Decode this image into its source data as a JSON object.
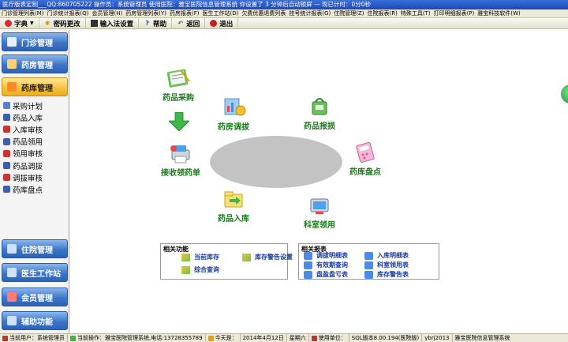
{
  "window": {
    "title": "医疗版表定制___QQ:860705222   操作员：系统管理员   使用医院：雅宝医院信息管理系统   你设置了 3 分钟后自动锁屏 — 现已计时：0分0秒"
  },
  "menu": [
    "门诊管理列表(M)",
    "门诊统计报表(Q)",
    "会员管理(H)",
    "药房管理列表(Y)",
    "药房报表(F)",
    "医生工作站(D)",
    "欠费优惠退费列表",
    "挂号统计报表(G)",
    "住院管理(Z)",
    "住院报表(R)",
    "特殊工具(T)",
    "打印明细报表(P)",
    "雅宝科技软件(W)"
  ],
  "toolbar": {
    "dictionary": "字典",
    "change_password": "密码更改",
    "input_method": "输入法设置",
    "help": "帮助",
    "back": "返回",
    "exit": "退出"
  },
  "sidebar": {
    "top_modules": [
      {
        "label": "门诊管理",
        "icon": "clinic-icon",
        "color": "#e8f0ff"
      },
      {
        "label": "药房管理",
        "icon": "pharmacy-icon",
        "color": "#ffd27a"
      },
      {
        "label": "药库管理",
        "icon": "warehouse-icon",
        "color": "#ff8a2a"
      }
    ],
    "sub_items": [
      {
        "label": "采购计划",
        "icon": "purchase-plan-icon",
        "color": "#5a7fcf"
      },
      {
        "label": "药品入库",
        "icon": "stock-in-icon",
        "color": "#3d5db0"
      },
      {
        "label": "入库审核",
        "icon": "stock-in-review-icon",
        "color": "#cc3333"
      },
      {
        "label": "药品领用",
        "icon": "drug-requisition-icon",
        "color": "#3d5db0"
      },
      {
        "label": "领用审核",
        "icon": "requisition-review-icon",
        "color": "#cc3333"
      },
      {
        "label": "药品调拔",
        "icon": "drug-transfer-icon",
        "color": "#3d5db0"
      },
      {
        "label": "调拔审核",
        "icon": "transfer-review-icon",
        "color": "#cc3333"
      },
      {
        "label": "药库盘点",
        "icon": "inventory-icon",
        "color": "#3d5db0"
      }
    ],
    "bottom_modules": [
      {
        "label": "住院管理",
        "icon": "inpatient-icon",
        "color": "#d0e0ff"
      },
      {
        "label": "医生工作站",
        "icon": "doctor-icon",
        "color": "#d0e0ff"
      },
      {
        "label": "会员管理",
        "icon": "member-icon",
        "color": "#ff7a7a"
      },
      {
        "label": "辅助功能",
        "icon": "tools-icon",
        "color": "#d0e0ff"
      }
    ]
  },
  "workflow": {
    "purchase": "药品采购",
    "transfer": "药房调拔",
    "loss": "药品报损",
    "receive": "接收领药单",
    "inventory": "药库盘点",
    "stock_in": "药品入库",
    "dept_requisition": "科室领用"
  },
  "related_functions": {
    "title": "相关功能",
    "items": [
      "当前库存",
      "库存警告设置",
      "综合查询"
    ]
  },
  "related_reports": {
    "title": "相关报表",
    "items": [
      "调拔明细表",
      "入库明细表",
      "有效期查询",
      "科室领用表",
      "盘盈盘亏表",
      "库存警告表"
    ]
  },
  "status": {
    "current_user": "当前用户：系统管理员",
    "current_op": "当前操作：雅宝医院管理系统,电话:13728355789",
    "today_label": "今天是：",
    "date": "2014年4月12日",
    "weekday": "星期六",
    "unit": "使用单位：",
    "version": "SQL版本8.00.194(医院版)",
    "code": "ybrj2013",
    "system": "雅宝医院信息管理系统"
  }
}
